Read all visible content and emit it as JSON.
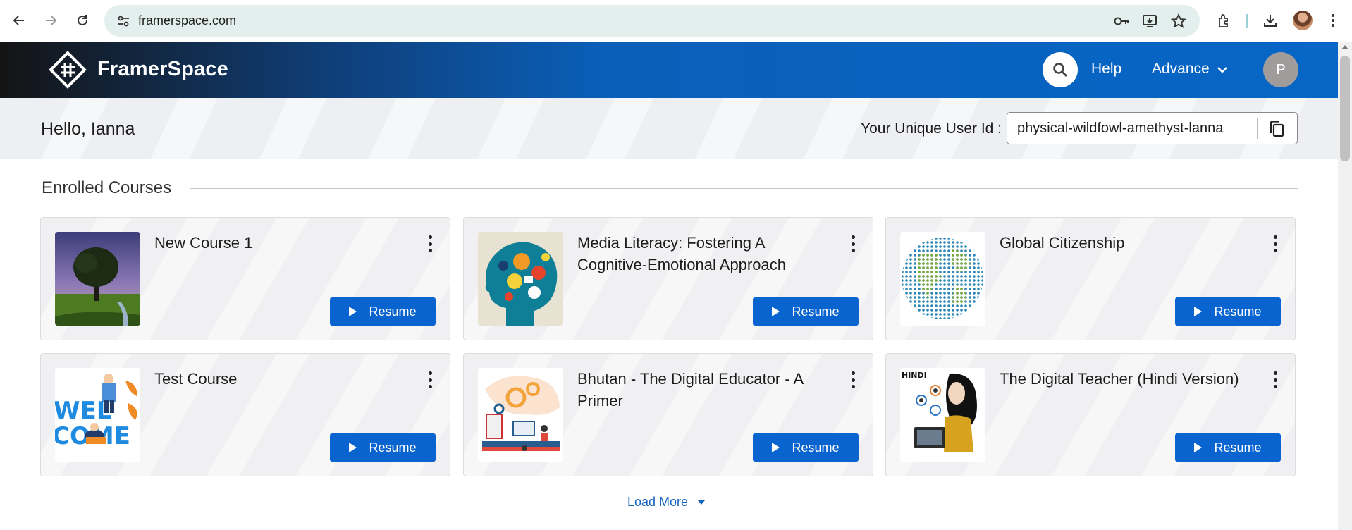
{
  "browser": {
    "url": "framerspace.com",
    "icons": [
      "back-icon",
      "forward-icon",
      "reload-icon",
      "site-info-icon",
      "password-key-icon",
      "install-app-icon",
      "bookmark-star-icon",
      "extensions-icon",
      "downloads-icon",
      "profile-avatar",
      "more-icon"
    ]
  },
  "header": {
    "brand": "FramerSpace",
    "help_label": "Help",
    "advance_label": "Advance",
    "avatar_initial": "P"
  },
  "greeting": {
    "hello_text": "Hello, Ianna",
    "uid_label": "Your Unique User Id :",
    "uid_value": "physical-wildfowl-amethyst-lanna"
  },
  "section": {
    "title": "Enrolled Courses"
  },
  "courses": [
    {
      "title": "New Course 1",
      "action": "Resume"
    },
    {
      "title": "Media Literacy: Fostering A Cognitive-Emotional Approach",
      "action": "Resume"
    },
    {
      "title": "Global Citizenship",
      "action": "Resume"
    },
    {
      "title": "Test Course",
      "action": "Resume"
    },
    {
      "title": "Bhutan - The Digital Educator - A Primer",
      "action": "Resume"
    },
    {
      "title": "The Digital Teacher (Hindi Version)",
      "action": "Resume"
    }
  ],
  "thumb_text": {
    "welcome_top": "WEL",
    "welcome_bottom": "COME",
    "hindi": "HINDI"
  },
  "load_more_label": "Load More",
  "colors": {
    "primary": "#0a64d0",
    "header_blue": "#0766c6",
    "link": "#1565c0"
  }
}
